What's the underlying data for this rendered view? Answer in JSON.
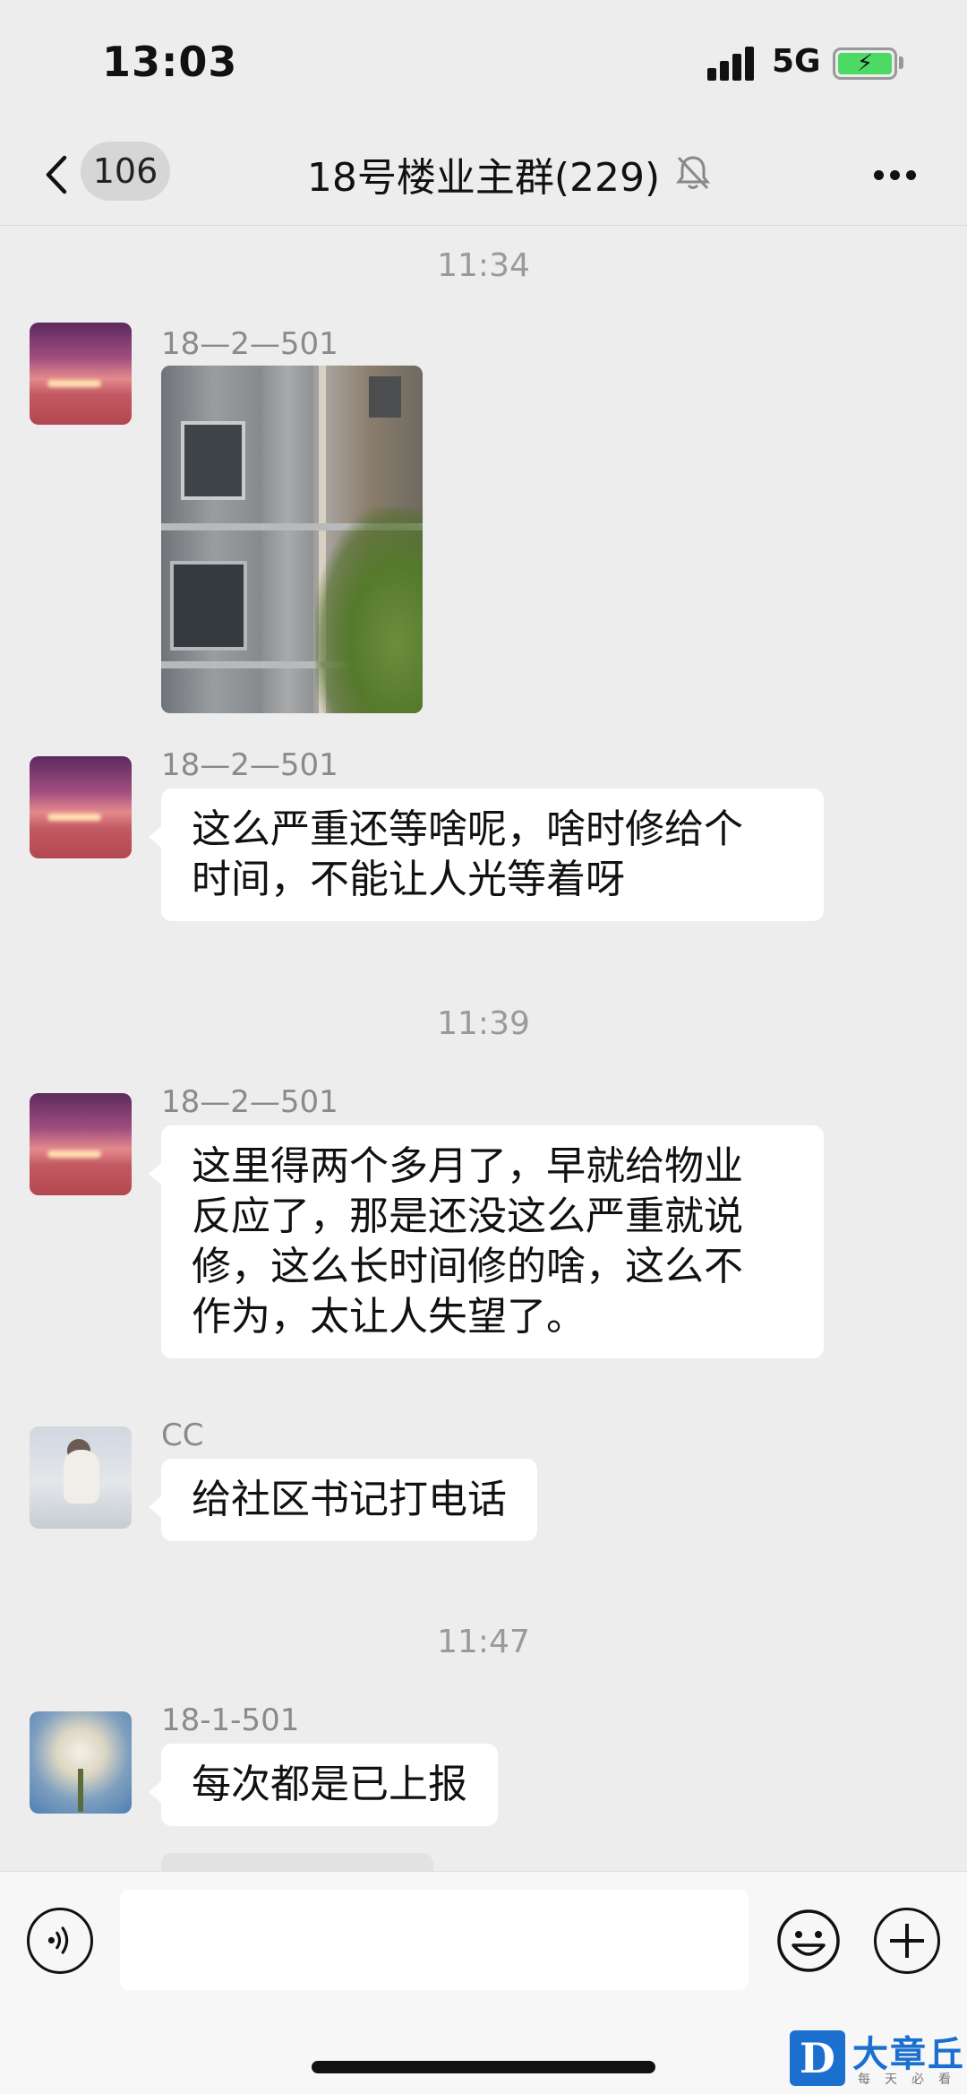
{
  "status_bar": {
    "time": "13:03",
    "network": "5G",
    "battery_icon": "battery-charging-icon"
  },
  "nav": {
    "unread_count": "106",
    "title": "18号楼业主群(229)",
    "mute_icon": "bell-slash-icon",
    "more_icon": "ellipsis-icon"
  },
  "chat": {
    "timestamps": [
      "11:34",
      "11:39",
      "11:47"
    ],
    "messages": [
      {
        "sender": "18—2—501",
        "type": "image",
        "avatar": "sunset"
      },
      {
        "sender": "18—2—501",
        "type": "text",
        "text_lines": [
          "这么严重还等啥呢，啥时修给个",
          "时间，不能让人光等着呀"
        ],
        "avatar": "sunset"
      },
      {
        "sender": "18—2—501",
        "type": "text",
        "text_lines": [
          "这里得两个多月了，早就给物业",
          "反应了，那是还没这么严重就说",
          "修，这么长时间修的啥，这么不",
          "作为，太让人失望了。"
        ],
        "avatar": "sunset"
      },
      {
        "sender": "CC",
        "type": "text",
        "text_lines": [
          "给社区书记打电话"
        ],
        "avatar": "baby"
      },
      {
        "sender": "18-1-501",
        "type": "text",
        "text_lines": [
          "每次都是已上报"
        ],
        "avatar": "flower"
      }
    ]
  },
  "input_bar": {
    "placeholder": "",
    "voice_icon": "voice-icon",
    "emoji_icon": "emoji-icon",
    "plus_icon": "plus-circle-icon"
  },
  "watermark": {
    "logo_letter": "D",
    "text": "大章丘",
    "sub": "每天必看"
  },
  "colors": {
    "background": "#ededed",
    "bubble": "#ffffff",
    "battery": "#4cd964",
    "watermark_blue": "#1b6fcf"
  }
}
